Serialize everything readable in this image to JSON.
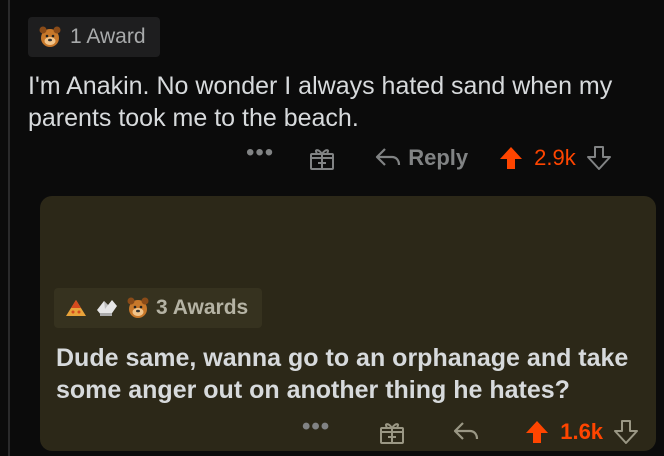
{
  "comment": {
    "award_label": "1 Award",
    "text": "I'm Anakin. No wonder I always hated sand when my parents took me to the beach.",
    "more": "•••",
    "reply_label": "Reply",
    "score": "2.9k",
    "award_icon": "bear-award-icon"
  },
  "reply": {
    "award_label": "3 Awards",
    "text": "Dude same, wanna go to an orphanage and take some anger out on another thing he hates?",
    "more": "•••",
    "score": "1.6k",
    "award_icons": [
      "cake-award-icon",
      "hands-award-icon",
      "bear-award-icon"
    ]
  },
  "colors": {
    "upvote": "#ff4500",
    "background": "#0b0b0b",
    "reply_card": "#2c2818",
    "muted": "#818384"
  }
}
